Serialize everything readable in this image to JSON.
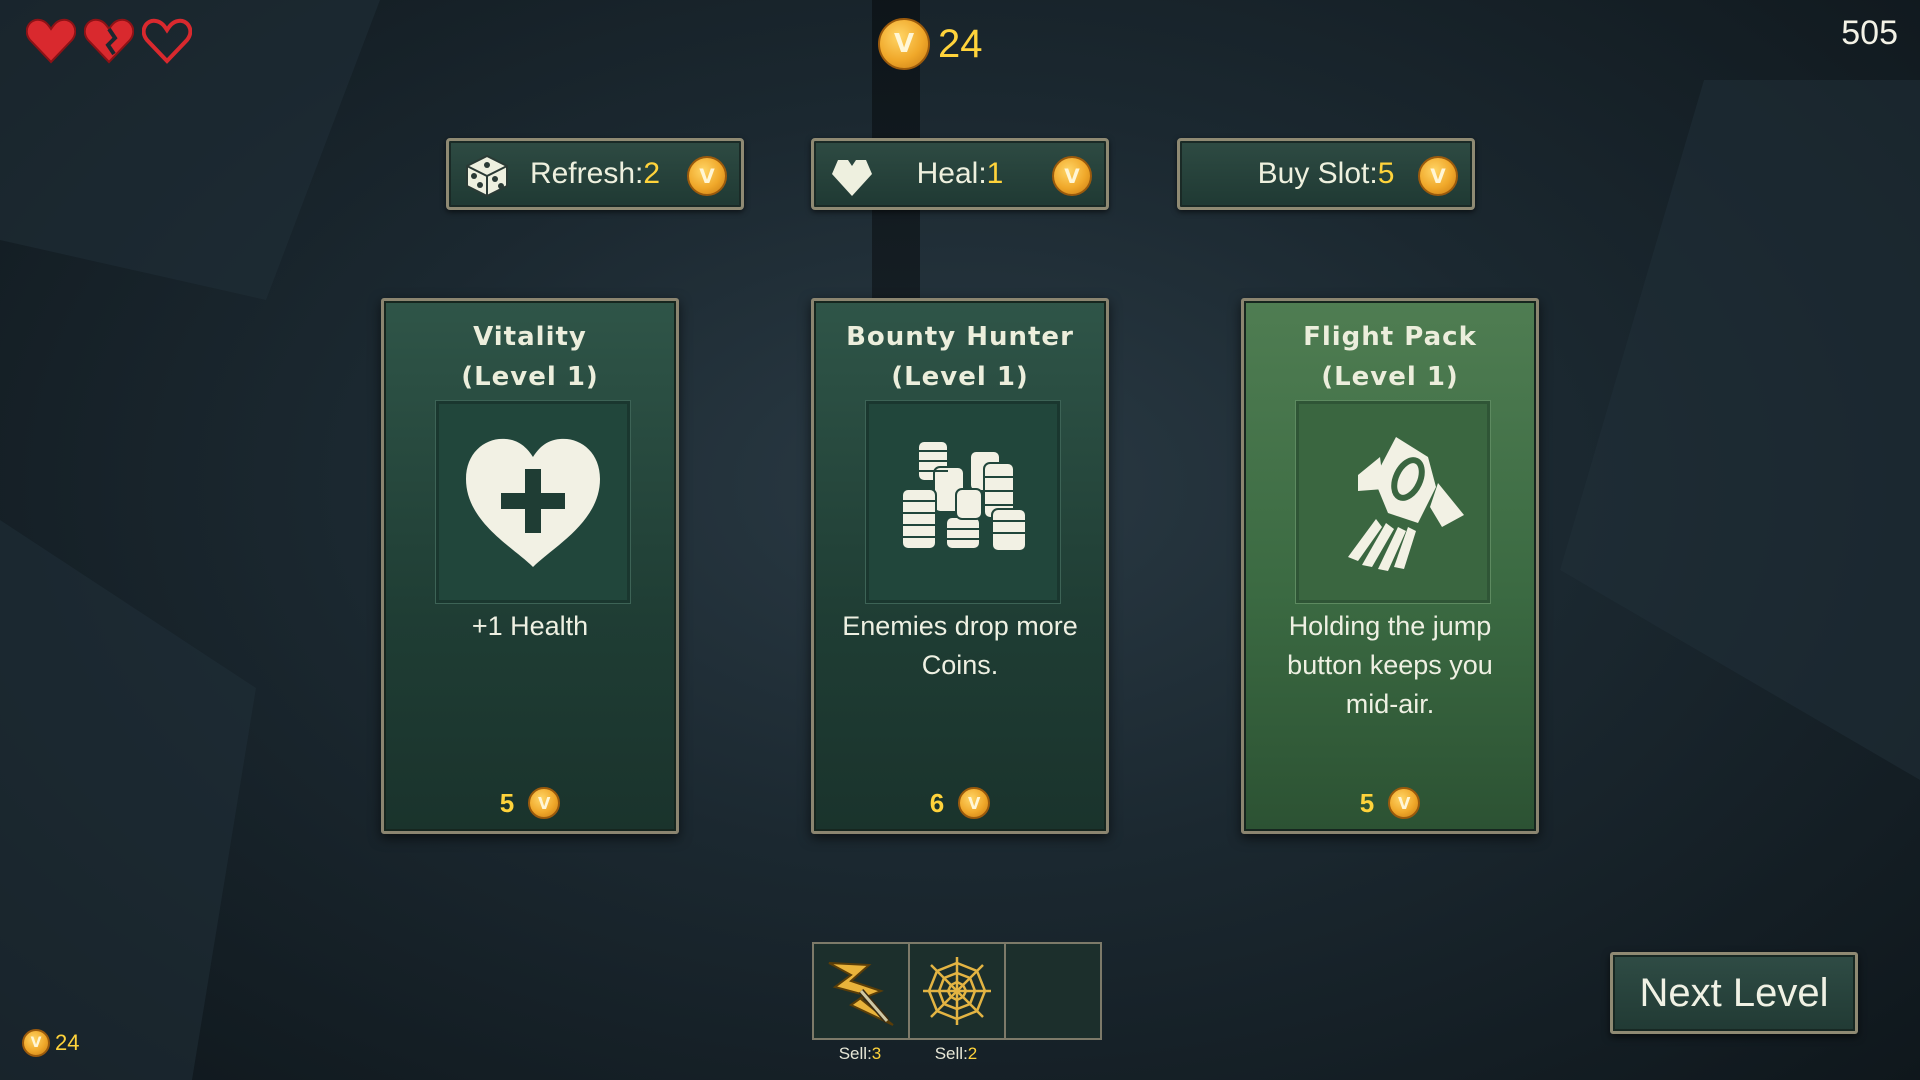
{
  "hud": {
    "hearts": [
      {
        "state": "full",
        "icon": "heart-full-icon"
      },
      {
        "state": "cracked",
        "icon": "heart-cracked-icon"
      },
      {
        "state": "empty",
        "icon": "heart-empty-icon"
      }
    ],
    "coins_top": "24",
    "score": "505",
    "coins_bottom": "24"
  },
  "shop_buttons": {
    "refresh": {
      "label": "Refresh:",
      "value": "2",
      "icon": "dice-icon"
    },
    "heal": {
      "label": "Heal:",
      "value": "1",
      "icon": "heart-icon"
    },
    "buy_slot": {
      "label": "Buy Slot:",
      "value": "5",
      "icon": ""
    }
  },
  "cards": [
    {
      "title": "Vitality",
      "level": "(Level 1)",
      "description": "+1 Health",
      "price": "5",
      "icon": "heart-plus-icon"
    },
    {
      "title": "Bounty Hunter",
      "level": "(Level 1)",
      "description": "Enemies drop more Coins.",
      "price": "6",
      "icon": "coin-stacks-icon"
    },
    {
      "title": "Flight Pack",
      "level": "(Level 1)",
      "description": "Holding the jump button keeps you mid-air.",
      "price": "5",
      "icon": "jetpack-icon"
    }
  ],
  "inventory": {
    "slots": [
      {
        "icon": "lightning-sword-icon",
        "sell_label": "Sell:",
        "sell_value": "3"
      },
      {
        "icon": "spider-web-icon",
        "sell_label": "Sell:",
        "sell_value": "2"
      },
      {
        "icon": "",
        "sell_label": "",
        "sell_value": ""
      }
    ]
  },
  "next_level_label": "Next Level",
  "colors": {
    "accent_gold": "#ffd33b",
    "card_green": "#1f3d34",
    "card_selected": "#3b6a42",
    "frame": "#8f8a73"
  }
}
